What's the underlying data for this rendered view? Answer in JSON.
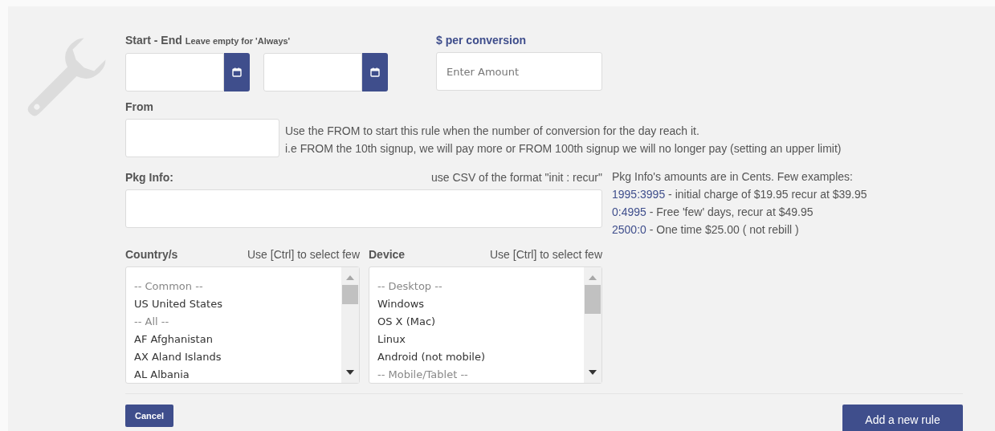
{
  "dates": {
    "label": "Start - End",
    "hint": "Leave empty for 'Always'"
  },
  "amount": {
    "label": "$ per conversion",
    "placeholder": "Enter Amount"
  },
  "from": {
    "label": "From",
    "help": [
      "Use the FROM to start this rule when the number of conversion for the day reach it.",
      "i.e FROM the 10th signup, we will pay more or FROM 100th signup we will no longer pay (setting an upper limit)"
    ]
  },
  "pkg": {
    "label": "Pkg Info:",
    "hint": "use CSV of the format \"init : recur\"",
    "notes_title": "Pkg Info's amounts are in Cents. Few examples:",
    "examples": [
      {
        "code": "1995:3995",
        "text": " - initial charge of $19.95 recur at $39.95"
      },
      {
        "code": "0:4995",
        "text": " - Free 'few' days, recur at $49.95"
      },
      {
        "code": "2500:0",
        "text": " - One time $25.00 ( not rebill )"
      }
    ]
  },
  "lists": [
    {
      "label": "Country/s",
      "hint": "Use [Ctrl] to select few",
      "options": [
        {
          "kind": "group",
          "text": "-- Common --"
        },
        {
          "kind": "option",
          "text": "US United States"
        },
        {
          "kind": "group",
          "text": "-- All --"
        },
        {
          "kind": "option",
          "text": "AF Afghanistan"
        },
        {
          "kind": "option",
          "text": "AX Aland Islands"
        },
        {
          "kind": "option",
          "text": "AL Albania"
        }
      ]
    },
    {
      "label": "Device",
      "hint": "Use [Ctrl] to select few",
      "options": [
        {
          "kind": "group",
          "text": "-- Desktop --"
        },
        {
          "kind": "option",
          "text": "Windows"
        },
        {
          "kind": "option",
          "text": "OS X (Mac)"
        },
        {
          "kind": "option",
          "text": "Linux"
        },
        {
          "kind": "option",
          "text": "Android (not mobile)"
        },
        {
          "kind": "group",
          "text": "-- Mobile/Tablet --"
        }
      ]
    }
  ],
  "buttons": {
    "cancel": "Cancel",
    "add": "Add a new rule"
  }
}
